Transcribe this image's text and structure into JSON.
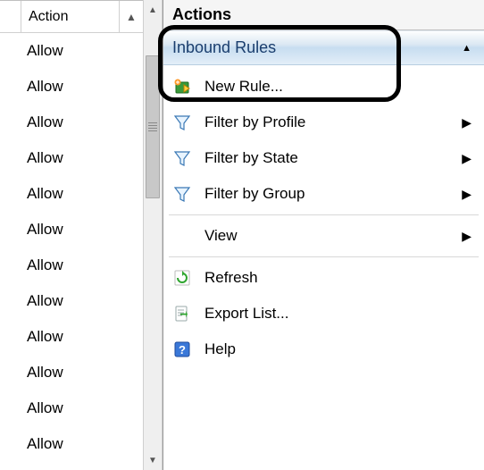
{
  "left": {
    "column_label": "Action",
    "sort_indicator": "▲",
    "rows": [
      "Allow",
      "Allow",
      "Allow",
      "Allow",
      "Allow",
      "Allow",
      "Allow",
      "Allow",
      "Allow",
      "Allow",
      "Allow",
      "Allow"
    ]
  },
  "right": {
    "panel_title": "Actions",
    "section_title": "Inbound Rules",
    "items": {
      "new_rule": {
        "label": "New Rule..."
      },
      "filter_profile": {
        "label": "Filter by Profile"
      },
      "filter_state": {
        "label": "Filter by State"
      },
      "filter_group": {
        "label": "Filter by Group"
      },
      "view": {
        "label": "View"
      },
      "refresh": {
        "label": "Refresh"
      },
      "export": {
        "label": "Export List..."
      },
      "help": {
        "label": "Help"
      }
    }
  }
}
